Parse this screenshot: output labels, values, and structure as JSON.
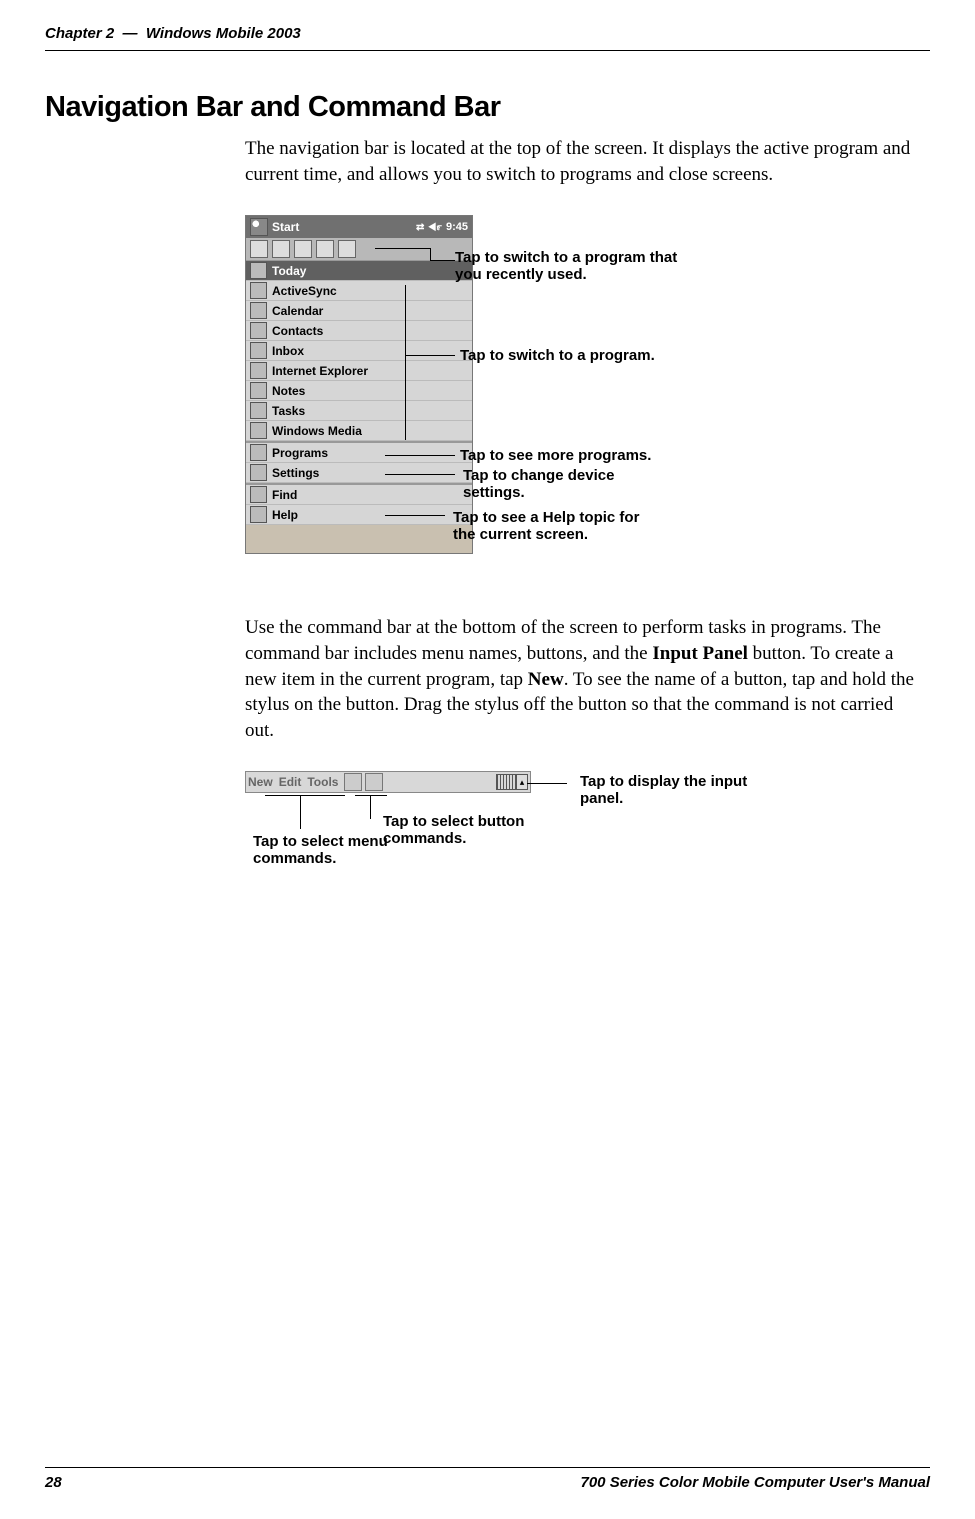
{
  "header": {
    "chapter": "Chapter 2",
    "separator": "—",
    "title": "Windows Mobile 2003"
  },
  "section_heading": "Navigation Bar and Command Bar",
  "para1": "The navigation bar is located at the top of the screen. It displays the active program and current time, and allows you to switch to programs and close screens.",
  "pda": {
    "start": "Start",
    "time": "9:45",
    "today": "Today",
    "items": {
      "activesync": "ActiveSync",
      "calendar": "Calendar",
      "contacts": "Contacts",
      "inbox": "Inbox",
      "ie": "Internet Explorer",
      "notes": "Notes",
      "tasks": "Tasks",
      "wmedia": "Windows Media",
      "programs": "Programs",
      "settings": "Settings",
      "find": "Find",
      "help": "Help"
    }
  },
  "callouts": {
    "recent": "Tap to switch to a program that you recently used.",
    "program": "Tap to switch to a program.",
    "more": "Tap to see more programs.",
    "settings": "Tap to change device settings.",
    "help": "Tap to see a Help topic for the current screen."
  },
  "para2_parts": {
    "a": "Use the command bar at the bottom of the screen to perform tasks in programs. The command bar includes menu names, buttons, and the ",
    "b": "Input Panel",
    "c": " button. To create a new item in the current program, tap ",
    "d": "New",
    "e": ". To see the name of a button, tap and hold the stylus on the button. Drag the stylus off the button so that the command is not carried out."
  },
  "cmdbar": {
    "menus": {
      "new": "New",
      "edit": "Edit",
      "tools": "Tools"
    }
  },
  "cb_callouts": {
    "input": "Tap to display the input panel.",
    "button": "Tap to select button commands.",
    "menu": "Tap to select menu commands."
  },
  "footer": {
    "page": "28",
    "manual": "700 Series Color Mobile Computer User's Manual"
  }
}
